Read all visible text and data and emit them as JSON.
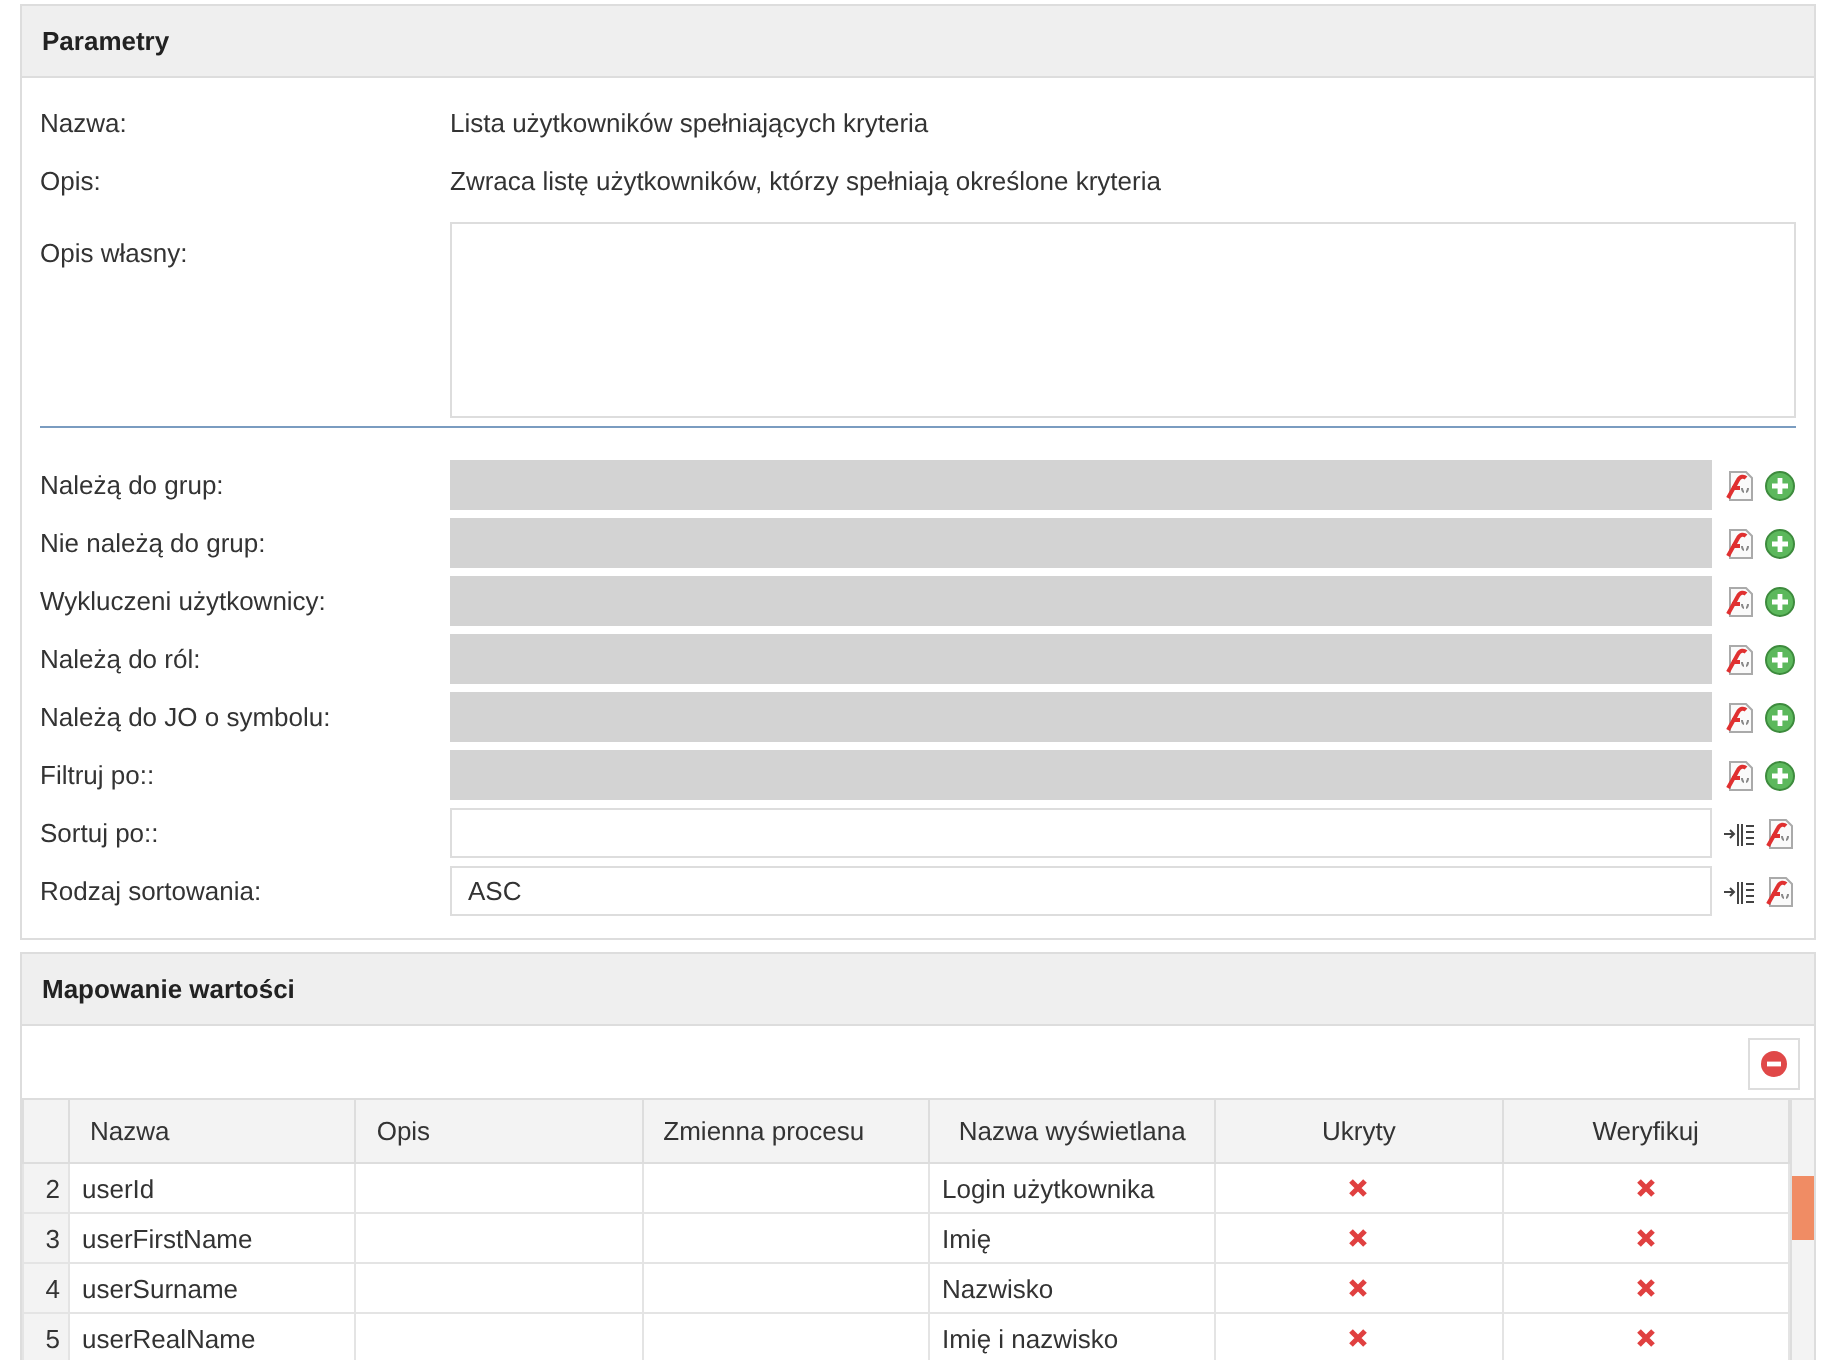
{
  "parameters": {
    "title": "Parametry",
    "info": [
      {
        "label": "Nazwa:",
        "value": "Lista użytkowników spełniających kryteria"
      },
      {
        "label": "Opis:",
        "value": "Zwraca listę użytkowników, którzy spełniają określone kryteria"
      }
    ],
    "custom_description": {
      "label": "Opis własny:"
    },
    "fields": [
      {
        "kind": "picker",
        "label": "Należą do grup:"
      },
      {
        "kind": "picker",
        "label": "Nie należą do grup:"
      },
      {
        "kind": "picker",
        "label": "Wykluczeni użytkownicy:"
      },
      {
        "kind": "picker",
        "label": "Należą do ról:"
      },
      {
        "kind": "picker",
        "label": "Należą do JO o symbolu:"
      },
      {
        "kind": "picker",
        "label": "Filtruj po::"
      },
      {
        "kind": "sort",
        "label": "Sortuj po::"
      },
      {
        "kind": "sort",
        "label": "Rodzaj sortowania:",
        "value": "ASC"
      }
    ]
  },
  "mapping": {
    "title": "Mapowanie wartości",
    "table": {
      "columns": [
        "Nazwa",
        "Opis",
        "Zmienna procesu",
        "Nazwa wyświetlana",
        "Ukryty",
        "Weryfikuj"
      ],
      "rows": [
        {
          "index": "2",
          "name": "userId",
          "display_name": "Login użytkownika",
          "hidden": false,
          "verify": false
        },
        {
          "index": "3",
          "name": "userFirstName",
          "display_name": "Imię",
          "hidden": false,
          "verify": false
        },
        {
          "index": "4",
          "name": "userSurname",
          "display_name": "Nazwisko",
          "hidden": false,
          "verify": false
        },
        {
          "index": "5",
          "name": "userRealName",
          "display_name": "Imię i nazwisko",
          "hidden": false,
          "verify": false
        }
      ]
    }
  }
}
